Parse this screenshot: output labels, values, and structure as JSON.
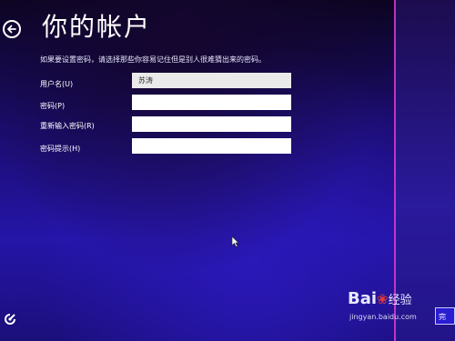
{
  "header": {
    "title": "你的帐户"
  },
  "instruction": "如果要设置密码，请选择那些你容易记住但是别人很难猜出来的密码。",
  "form": {
    "username_label": "用户名(U)",
    "username_value": "苏涛",
    "password_label": "密码(P)",
    "password_value": "",
    "confirm_label": "重新输入密码(R)",
    "confirm_value": "",
    "hint_label": "密码提示(H)",
    "hint_value": ""
  },
  "watermark": {
    "brand_prefix": "Bai",
    "brand_paw": "❀",
    "brand_suffix": "经验",
    "url": "jingyan.baidu.com"
  },
  "next_button_label": "完"
}
